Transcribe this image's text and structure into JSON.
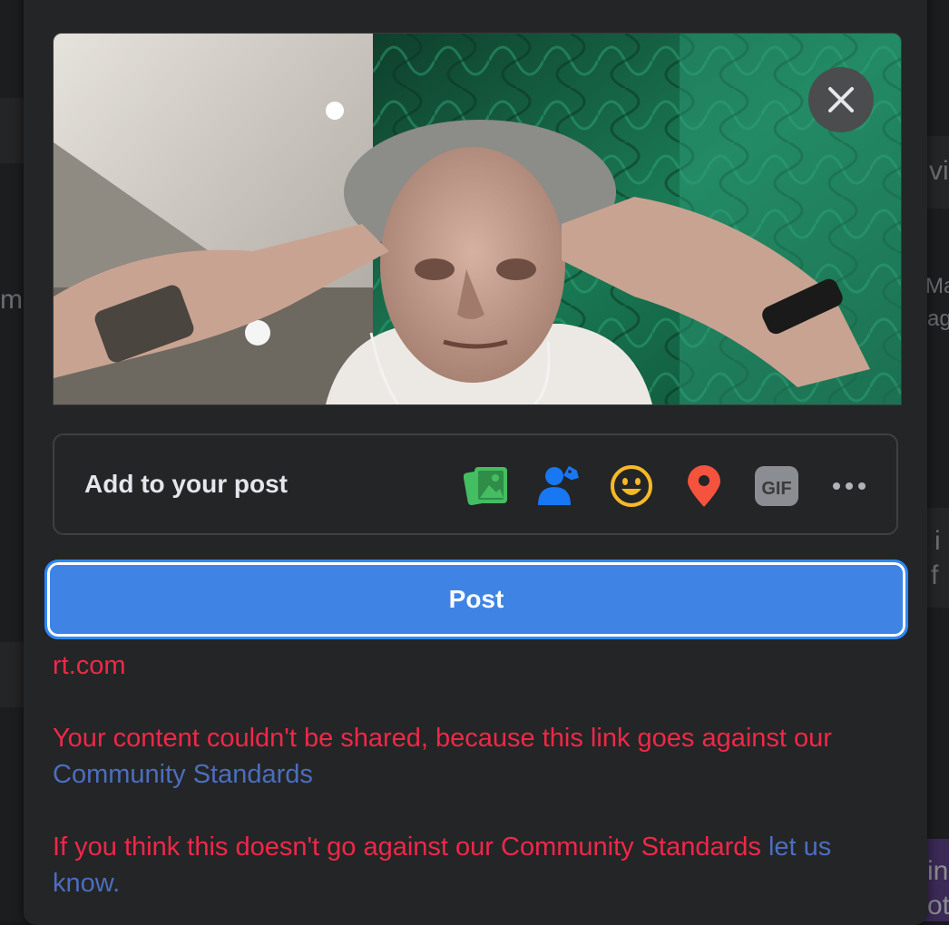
{
  "post_composer": {
    "add_to_post": {
      "label": "Add to your post",
      "icons": [
        {
          "name": "photo-video-icon",
          "color": "#45bd62"
        },
        {
          "name": "tag-people-icon",
          "color": "#1877f2"
        },
        {
          "name": "feeling-activity-icon",
          "color": "#f7b928"
        },
        {
          "name": "check-in-icon",
          "color": "#f5533d"
        },
        {
          "name": "gif-icon",
          "color": "#8a8d91",
          "text": "GIF"
        },
        {
          "name": "more-options-icon",
          "color": "#b0b3b8"
        }
      ]
    },
    "post_button": {
      "label": "Post"
    },
    "link_domain": "rt.com",
    "error_message": {
      "line1": "Your content couldn't be shared, because this link goes against our",
      "line1_link": "Community Standards",
      "line2": "If you think this doesn't go against our Community Standards",
      "line2_link": "let us",
      "line2_link_cont": "know."
    }
  },
  "background_fragments": {
    "left_m": "m",
    "right_vi": "vi",
    "right_ma": "Ma",
    "right_ag": "ag",
    "right_i": "i",
    "right_f": "f",
    "right_in": "in",
    "right_ot": "ot"
  },
  "colors": {
    "accent": "#3f84e5",
    "error": "#f02849",
    "link": "#4b6ebf",
    "modal_bg": "#242526"
  }
}
